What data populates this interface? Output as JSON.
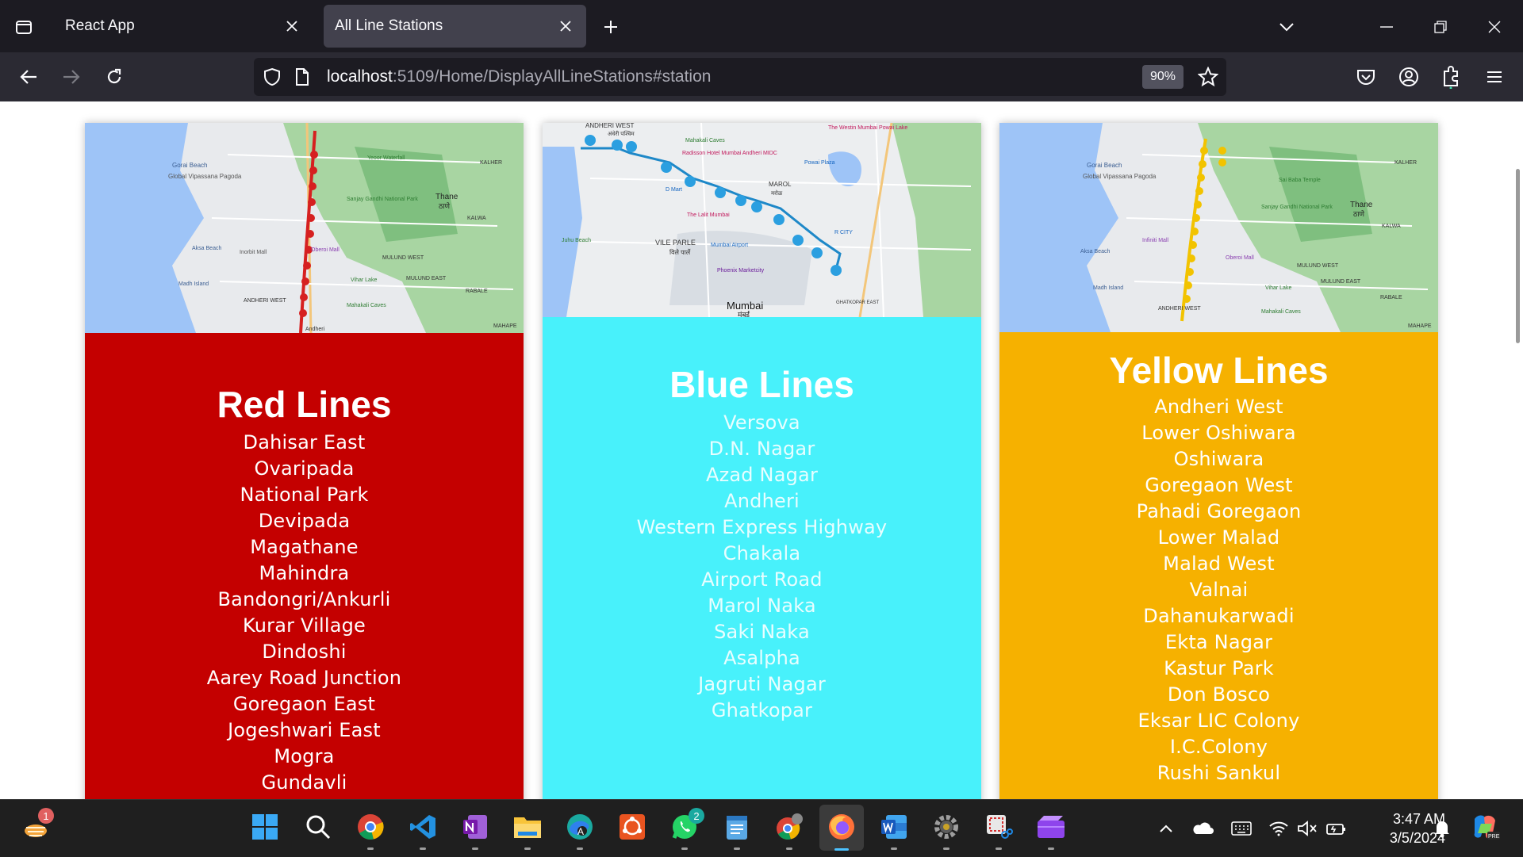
{
  "browser": {
    "tabs": [
      {
        "title": "React App",
        "active": false
      },
      {
        "title": "All Line Stations",
        "active": true
      }
    ],
    "url": {
      "host": "localhost",
      "path": ":5109/Home/DisplayAllLineStations#station"
    },
    "zoom": "90%"
  },
  "map_labels": {
    "red_map": [
      "Gorai Beach",
      "Global Vipassana Pagoda",
      "KALHER",
      "Yeoor Waterfall",
      "Sanjay Gandhi National Park",
      "Thane",
      "ठाणे",
      "KALWA",
      "Aksa Beach",
      "Inorbit Mall",
      "Oberoi Mall",
      "MULUND WEST",
      "MULUND EAST",
      "Madh Island",
      "Vihar Lake",
      "ANDHERI WEST",
      "Mahakali Caves",
      "RABALE",
      "MAHAPE",
      "Andheri"
    ],
    "blue_map": [
      "ANDHERI WEST",
      "अंधेरी पश्चिम",
      "The Westin Mumbai Powai Lake",
      "Mahakali Caves",
      "Radisson Hotel Mumbai Andheri MIDC",
      "Powai Plaza",
      "D Mart",
      "MAROL",
      "मरोळ",
      "Juhu Beach",
      "VILE PARLE",
      "विले पार्ले",
      "The Lalit Mumbai",
      "Mumbai Airport",
      "R CITY",
      "Phoenix Marketcity",
      "GHATKOPAR EAST",
      "Mumbai",
      "मुंबई"
    ],
    "yellow_map": [
      "Gorai Beach",
      "Global Vipassana Pagoda",
      "KALHER",
      "Sai Baba Temple",
      "Sanjay Gandhi National Park",
      "Thane",
      "ठाणे",
      "KALWA",
      "Aksa Beach",
      "Infiniti Mall",
      "Oberoi Mall",
      "MULUND WEST",
      "MULUND EAST",
      "Madh Island",
      "Vihar Lake",
      "ANDHERI WEST",
      "Mahakali Caves",
      "RABALE",
      "MAHAPE"
    ]
  },
  "lines": {
    "red": {
      "title": "Red Lines",
      "stations": [
        "Dahisar East",
        "Ovaripada",
        "National Park",
        "Devipada",
        "Magathane",
        "Mahindra",
        "Bandongri/Ankurli",
        "Kurar Village",
        "Dindoshi",
        "Aarey Road Junction",
        "Goregaon East",
        "Jogeshwari East",
        "Mogra",
        "Gundavli"
      ]
    },
    "blue": {
      "title": "Blue Lines",
      "stations": [
        "Versova",
        "D.N. Nagar",
        "Azad Nagar",
        "Andheri",
        "Western Express Highway",
        "Chakala",
        "Airport Road",
        "Marol Naka",
        "Saki Naka",
        "Asalpha",
        "Jagruti Nagar",
        "Ghatkopar"
      ]
    },
    "yellow": {
      "title": "Yellow Lines",
      "stations": [
        "Andheri West",
        "Lower Oshiwara",
        "Oshiwara",
        "Goregaon West",
        "Pahadi Goregaon",
        "Lower Malad",
        "Malad West",
        "Valnai",
        "Dahanukarwadi",
        "Ekta Nagar",
        "Kastur Park",
        "Don Bosco",
        "Eksar LIC Colony",
        "I.C.Colony",
        "Rushi Sankul"
      ]
    }
  },
  "colors": {
    "red": "#c40000",
    "blue": "#48f1fb",
    "yellow": "#f6b100"
  },
  "taskbar": {
    "icons": [
      "widgets-icon",
      "start-icon",
      "search-icon",
      "chrome-icon",
      "vscode-icon",
      "onenote-icon",
      "file-explorer-icon",
      "edge-icon",
      "office-icon",
      "whatsapp-icon",
      "notepad-icon",
      "chrome-profile-icon",
      "firefox-icon",
      "word-icon",
      "settings-icon",
      "snipping-tool-icon",
      "clipchamp-icon"
    ],
    "widgets_badge": "1",
    "whatsapp_badge": "2",
    "time": "3:47 AM",
    "date": "3/5/2024"
  }
}
